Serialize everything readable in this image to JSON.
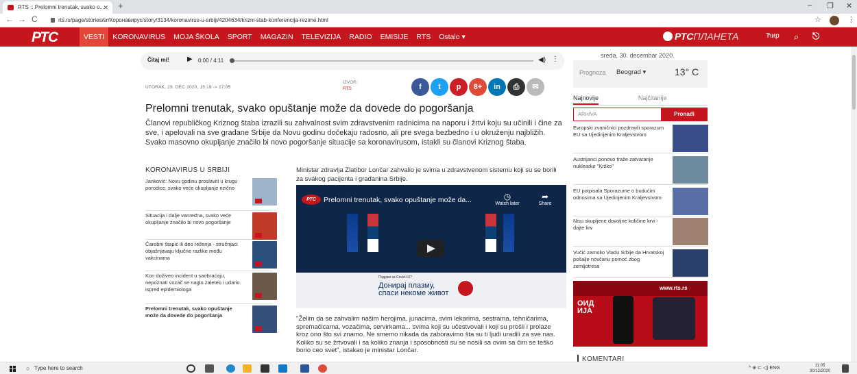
{
  "browser": {
    "tab_title": "RTS :: Prelomni trenutak, svako o...",
    "url": "rts.rs/page/stories/sr/Коронавирус/story/3134/koronavirus-u-srbiji/4204634/krizni-stab-konferencija-rezime.html",
    "new_tab": "+",
    "minimize": "–",
    "maximize": "❐",
    "close": "✕"
  },
  "site": {
    "logo": "РТС",
    "menu": [
      "VESTI",
      "KORONAVIRUS",
      "MOJA ŠKOLA",
      "SPORT",
      "MAGAZIN",
      "TELEVIZIJA",
      "RADIO",
      "EMISIJE",
      "RTS",
      "Ostalo ▾"
    ],
    "planeta_brand": "РТС",
    "planeta_suffix": "ПЛАНЕТА",
    "cyr_toggle": "Ћир"
  },
  "audio": {
    "label": "Čitaj mi!",
    "time": "0:00 / 4:11",
    "progress": 0
  },
  "article": {
    "dateline": "UTORAK, 29. DEC 2020, 15:19 -> 17:05",
    "source_label": "IZVOR:",
    "source_value": "RTS",
    "headline": "Prelomni trenutak, svako opuštanje može da dovede do pogoršanja",
    "lead": "Članovi republičkog Kriznog štaba izrazili su zahvalnost svim zdravstvenim radnicima na naporu i žrtvi koju su učinili i čine za sve, i apelovali na sve građane Srbije da Novu godinu dočekaju radosno, ali pre svega bezbedno i u okruženju najbližih. Svako masovno okupljanje značilo bi novo pogoršanje situacije sa koronavirusom, istakli su članovi Kriznog štaba.",
    "body1": "Ministar zdravlja Zlatibor Lončar zahvalio je svima u zdravstvenom sistemu koji su se borili za svakog pacijenta i građanina Srbije.",
    "quote": "\"Želim da se zahvalim našim herojima, junacima, svim lekarima, sestrama, tehničarima, spremačicama, vozačima, servirkama... svima koji su učestvovali i koji su prošli i prolaze kroz ono što svi znamo. Ne smemo nikada da zaboravimo šta su ti ljudi uradili za sve nas. Koliko su se žrtvovali i sa koliko znanja i sposobnosti su se nosili sa ovim sa čim se teško borio ceo svet\", istakao je ministar Lončar."
  },
  "video": {
    "title": "Prelomni trenutak, svako opuštanje može da...",
    "logo": "РТС",
    "watch_later": "Watch later",
    "share": "Share",
    "banner_small": "Подржи за Covid-19?",
    "banner_text": "Донирај плазму,\nспаси некоме живот"
  },
  "related": {
    "heading": "KORONAVIRUS U SRBIJI",
    "items": [
      {
        "title": "Janković: Novu godinu proslaviti u krugu porodice, svako veće okupljanje rizično",
        "color": "#9fb3c8"
      },
      {
        "title": "Situacija i dalje vanredna, svako veće okupljanje značilo bi novo pogoršanje",
        "color": "#c23a2a"
      },
      {
        "title": "Čarobni štapić ili deo rešenja - stručnjaci objašnjavaju ključne razlike među vakcinama",
        "color": "#2d4f7c"
      },
      {
        "title": "Kon doživeo incident u saobraćaju, nepoznati vozač se naglo zaleteo i udario ispred epidemiologa",
        "color": "#6b5a4a"
      },
      {
        "title": "Prelomni trenutak, svako opuštanje može da dovede do pogoršanja",
        "color": "#34507a"
      }
    ]
  },
  "sidebar": {
    "date": "sreda, 30. decembar 2020.",
    "forecast_label": "Prognoza",
    "city": "Beograd ▾",
    "temperature": "13° C",
    "tab_latest": "Najnovije",
    "tab_most_read": "Najčitanije",
    "archive_placeholder": "ARHIVA",
    "find_button": "Pronađi",
    "news": [
      {
        "title": "Evropski zvaničnici pozdravili sporazum EU sa Ujedinjenim Kraljevstvom",
        "color": "#3a4f8a"
      },
      {
        "title": "Austrijanci ponovo traže zatvaranje nuklearke \"Krško\"",
        "color": "#6d8a9e"
      },
      {
        "title": "EU potpisala Sporazume o budućim odnosima sa Ujedinjenim Kraljevstvom",
        "color": "#5a6fa8"
      },
      {
        "title": "Nisu skupljene dovoljne količine krvi - dajte krv",
        "color": "#a08070"
      },
      {
        "title": "Vučić zamolio Vladu Srbije da Hrvatskoj pošalje novčanu pomoć zbog zemljotresa",
        "color": "#2a3f6a"
      }
    ],
    "ad_head": "www.rts.rs",
    "ad_text": "ОИД\nИЈА",
    "comments": "KOMENTARI"
  },
  "share_buttons": [
    {
      "name": "facebook",
      "glyph": "f",
      "color": "#3b5998"
    },
    {
      "name": "twitter",
      "glyph": "t",
      "color": "#1da1f2"
    },
    {
      "name": "pinterest",
      "glyph": "p",
      "color": "#cb2027"
    },
    {
      "name": "googleplus",
      "glyph": "8+",
      "color": "#dd4b39"
    },
    {
      "name": "linkedin",
      "glyph": "in",
      "color": "#0077b5"
    },
    {
      "name": "print",
      "glyph": "⎙",
      "color": "#333333"
    },
    {
      "name": "email",
      "glyph": "✉",
      "color": "#bbbbbb"
    }
  ],
  "taskbar": {
    "search_placeholder": "Type here to search",
    "tray": "^ ⊕ ⊏ ◁) ENG",
    "time": "11:05",
    "date": "30/12/2020"
  }
}
